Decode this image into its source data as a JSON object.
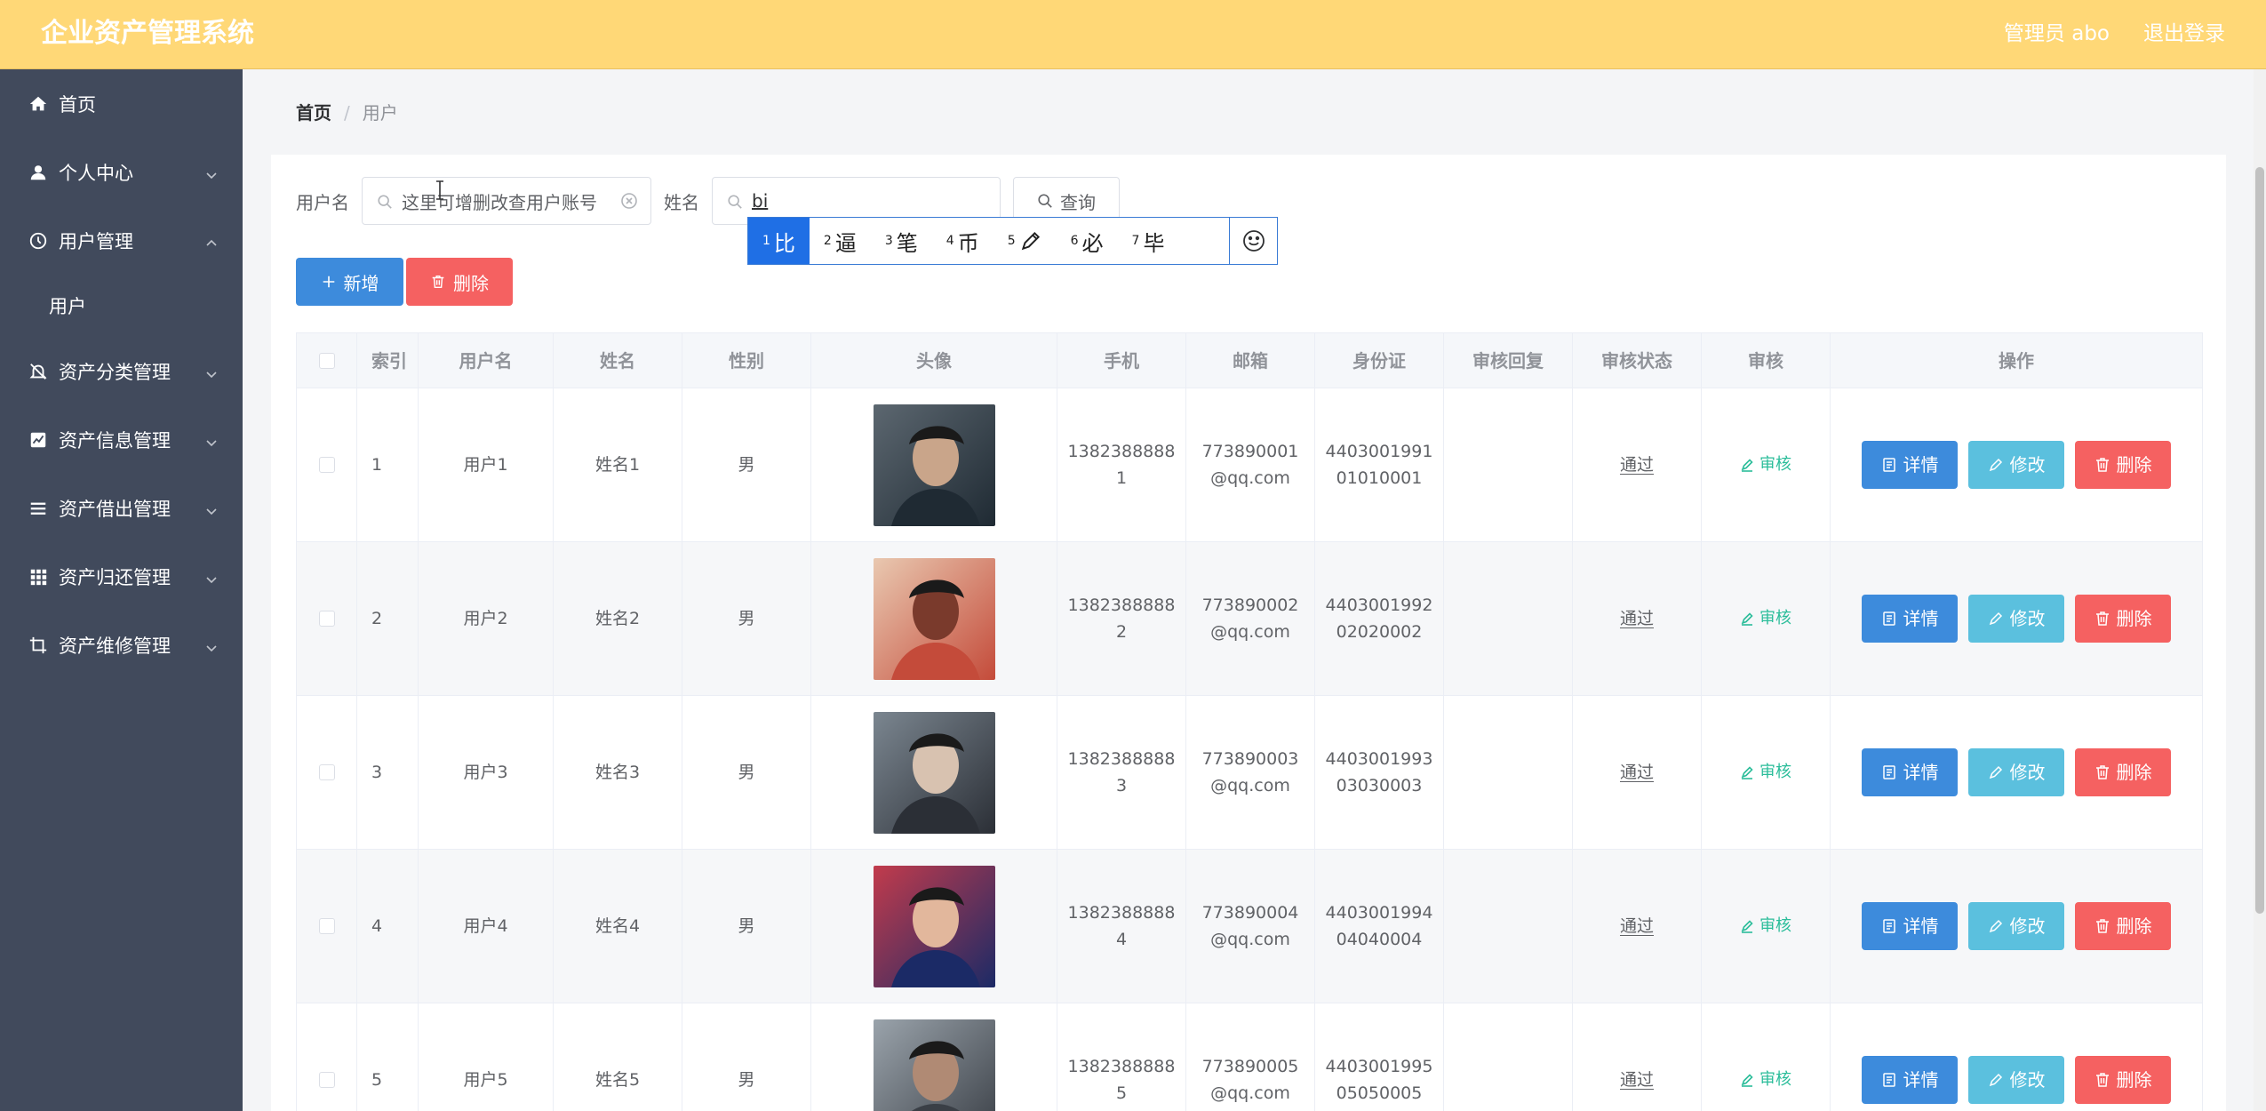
{
  "header": {
    "title": "企业资产管理系统",
    "user": "管理员 abo",
    "logout": "退出登录"
  },
  "sidebar": {
    "items": [
      {
        "label": "首页",
        "icon": "home-icon"
      },
      {
        "label": "个人中心",
        "icon": "user-icon"
      },
      {
        "label": "用户管理",
        "icon": "clock-icon"
      },
      {
        "label": "资产分类管理",
        "icon": "bell-off-icon"
      },
      {
        "label": "资产信息管理",
        "icon": "chart-icon"
      },
      {
        "label": "资产借出管理",
        "icon": "menu-icon"
      },
      {
        "label": "资产归还管理",
        "icon": "grid-icon"
      },
      {
        "label": "资产维修管理",
        "icon": "crop-icon"
      }
    ],
    "sub_user": "用户"
  },
  "breadcrumb": {
    "home": "首页",
    "sep": "/",
    "current": "用户"
  },
  "search": {
    "username_label": "用户名",
    "username_placeholder": "这里可增删改查用户账号",
    "name_label": "姓名",
    "name_value": "bi",
    "search_button": "查询"
  },
  "actions": {
    "add": "新增",
    "delete": "删除"
  },
  "ime": {
    "candidates": [
      {
        "num": "1",
        "text": "比"
      },
      {
        "num": "2",
        "text": "逼"
      },
      {
        "num": "3",
        "text": "笔"
      },
      {
        "num": "4",
        "text": "币"
      },
      {
        "num": "5",
        "text": ""
      },
      {
        "num": "6",
        "text": "必"
      },
      {
        "num": "7",
        "text": "毕"
      }
    ]
  },
  "table": {
    "headers": [
      "索引",
      "用户名",
      "姓名",
      "性别",
      "头像",
      "手机",
      "邮箱",
      "身份证",
      "审核回复",
      "审核状态",
      "审核",
      "操作"
    ],
    "rows": [
      {
        "index": "1",
        "username": "用户1",
        "name": "姓名1",
        "gender": "男",
        "phone": "1382388888\n1",
        "email": "773890001\n@qq.com",
        "idcard": "4403001991\n01010001",
        "reply": "",
        "status": "通过",
        "audit": "审核"
      },
      {
        "index": "2",
        "username": "用户2",
        "name": "姓名2",
        "gender": "男",
        "phone": "1382388888\n2",
        "email": "773890002\n@qq.com",
        "idcard": "4403001992\n02020002",
        "reply": "",
        "status": "通过",
        "audit": "审核"
      },
      {
        "index": "3",
        "username": "用户3",
        "name": "姓名3",
        "gender": "男",
        "phone": "1382388888\n3",
        "email": "773890003\n@qq.com",
        "idcard": "4403001993\n03030003",
        "reply": "",
        "status": "通过",
        "audit": "审核"
      },
      {
        "index": "4",
        "username": "用户4",
        "name": "姓名4",
        "gender": "男",
        "phone": "1382388888\n4",
        "email": "773890004\n@qq.com",
        "idcard": "4403001994\n04040004",
        "reply": "",
        "status": "通过",
        "audit": "审核"
      },
      {
        "index": "5",
        "username": "用户5",
        "name": "姓名5",
        "gender": "男",
        "phone": "1382388888\n5",
        "email": "773890005\n@qq.com",
        "idcard": "4403001995\n05050005",
        "reply": "",
        "status": "通过",
        "audit": "审核"
      }
    ],
    "op_labels": {
      "detail": "详情",
      "edit": "修改",
      "delete": "删除"
    }
  },
  "colors": {
    "header": "#ffd877",
    "sidebar": "#414a5c",
    "primary": "#3d8bdc",
    "info": "#5bc0de",
    "danger": "#f56161",
    "success": "#2bbd9a"
  }
}
